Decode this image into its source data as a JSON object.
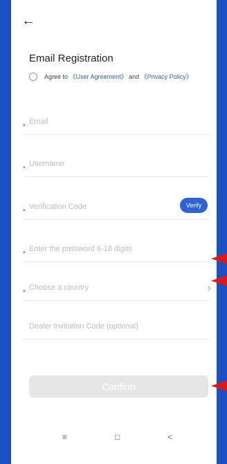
{
  "header": {
    "back_icon": "arrow-left-icon"
  },
  "form": {
    "title": "Email Registration",
    "agreement": {
      "prefix": "Agree to",
      "user_agreement": "《User Agreement》",
      "and": "and",
      "privacy_policy": "《Privacy Policy》"
    },
    "fields": {
      "email": "Email",
      "username": "Username",
      "verification_code": "Verification Code",
      "verify_button": "Verify",
      "password": "Enter the password 6-18 digits",
      "country": "Choose a country",
      "dealer_code": "Dealer Invitation Code (optional)"
    },
    "confirm_label": "Confirm"
  },
  "nav": {
    "menu_icon": "≡",
    "home_icon": "□",
    "back_icon": "<"
  },
  "colors": {
    "background": "#1d4fc4",
    "accent": "#2f62d3",
    "required_star": "#d33",
    "annotation_arrow": "#d91a1a"
  }
}
